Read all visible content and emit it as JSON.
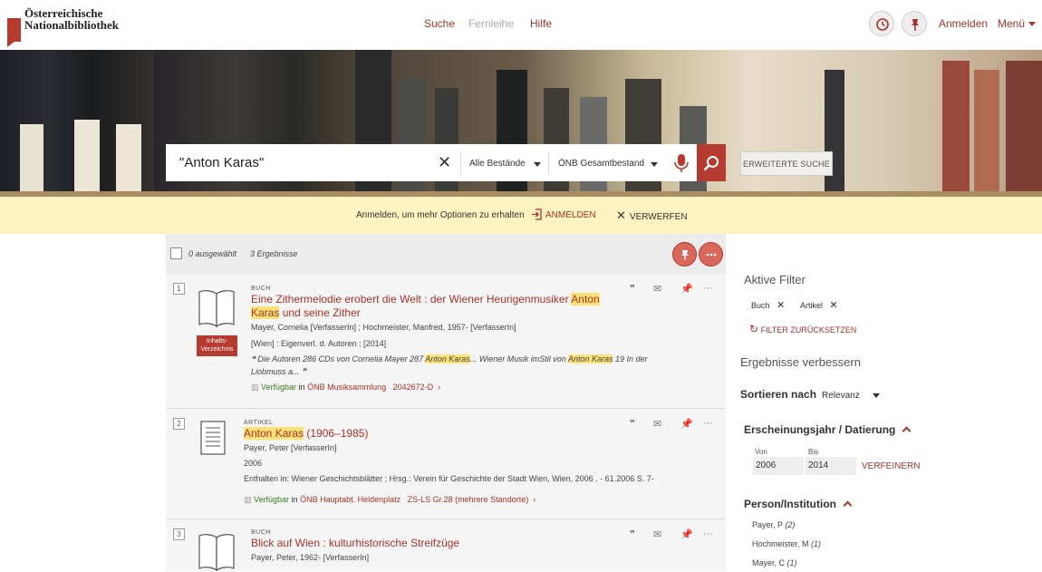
{
  "header": {
    "logo_line1": "Österreichische",
    "logo_line2": "Nationalbibliothek",
    "nav": [
      "Suche",
      "Fernleihe",
      "Hilfe"
    ],
    "login": "Anmelden",
    "menu": "Menü"
  },
  "search": {
    "query": "\"Anton Karas\"",
    "scope": "Alle Bestände",
    "collection": "ÖNB Gesamtbestand",
    "advanced": "ERWEITERTE SUCHE"
  },
  "notice": {
    "text": "Anmelden, um mehr Optionen zu erhalten",
    "login": "ANMELDEN",
    "dismiss": "VERWERFEN"
  },
  "results_bar": {
    "selected": "0 ausgewählt",
    "count": "3 Ergebnisse"
  },
  "records": [
    {
      "num": "1",
      "type": "BUCH",
      "title_a": "Eine Zithermelodie erobert die Welt : der Wiener Heurigenmusiker ",
      "title_hl1": "Anton",
      "title_hl2": "Karas",
      "title_b": " und seine Zither",
      "authors": "Mayer, Cornelia [VerfasserIn] ; Hochmeister, Manfred, 1957- [VerfasserIn]",
      "publisher": "[Wien] : Eigenverl. d. Autoren ; [2014]",
      "snippet_a": "❝ Die Autoren 286 CDs von Cornelia Mayer 287 ",
      "snippet_hl1": "Anton Karas",
      "snippet_b": "... Wiener Musik imStil von ",
      "snippet_hl2": "Anton Karas",
      "snippet_c": " 19 In der",
      "snippet_d": "Liobmuss a... ❞",
      "avail": "Verfügbar",
      "avail_in": " in ",
      "location": "ÖNB Musiksammlung",
      "signature": "2042672-D",
      "badge": "Inhalts-\nVerzeichnis"
    },
    {
      "num": "2",
      "type": "ARTIKEL",
      "title_hl": "Anton Karas",
      "title_b": " (1906–1985)",
      "authors": "Payer, Peter [VerfasserIn]",
      "year": "2006",
      "contained": "Enthalten in: Wiener Geschichtsblätter ; Hrsg.: Verein für Geschichte der Stadt Wien, Wien, 2006 . - 61.2006 S. 7-",
      "avail": "Verfügbar",
      "avail_in": " in ",
      "location": "ÖNB Hauptabt. Heldenplatz",
      "signature": "ZS-LS Gr.28 (mehrere Standorte)"
    },
    {
      "num": "3",
      "type": "BUCH",
      "title": "Blick auf Wien : kulturhistorische Streifzüge",
      "authors": "Payer, Peter, 1962- [VerfasserIn]"
    }
  ],
  "sidebar": {
    "active_filters": "Aktive Filter",
    "chips": [
      "Buch",
      "Artikel"
    ],
    "reset": "FILTER ZURÜCKSETZEN",
    "improve": "Ergebnisse verbessern",
    "sort_label": "Sortieren nach",
    "sort_value": "Relevanz",
    "year_heading": "Erscheinungsjahr / Datierung",
    "from_label": "Von",
    "to_label": "Bis",
    "from_value": "2006",
    "to_value": "2014",
    "refine": "VERFEINERN",
    "person_heading": "Person/Institution",
    "persons": [
      {
        "name": "Payer, P",
        "count": "(2)"
      },
      {
        "name": "Hochmeister, M",
        "count": "(1)"
      },
      {
        "name": "Mayer, C",
        "count": "(1)"
      }
    ]
  },
  "colors": {
    "accent": "#b53a2f",
    "notice": "#fcf3c0",
    "highlight": "#fde277",
    "available": "#3c7a24"
  }
}
